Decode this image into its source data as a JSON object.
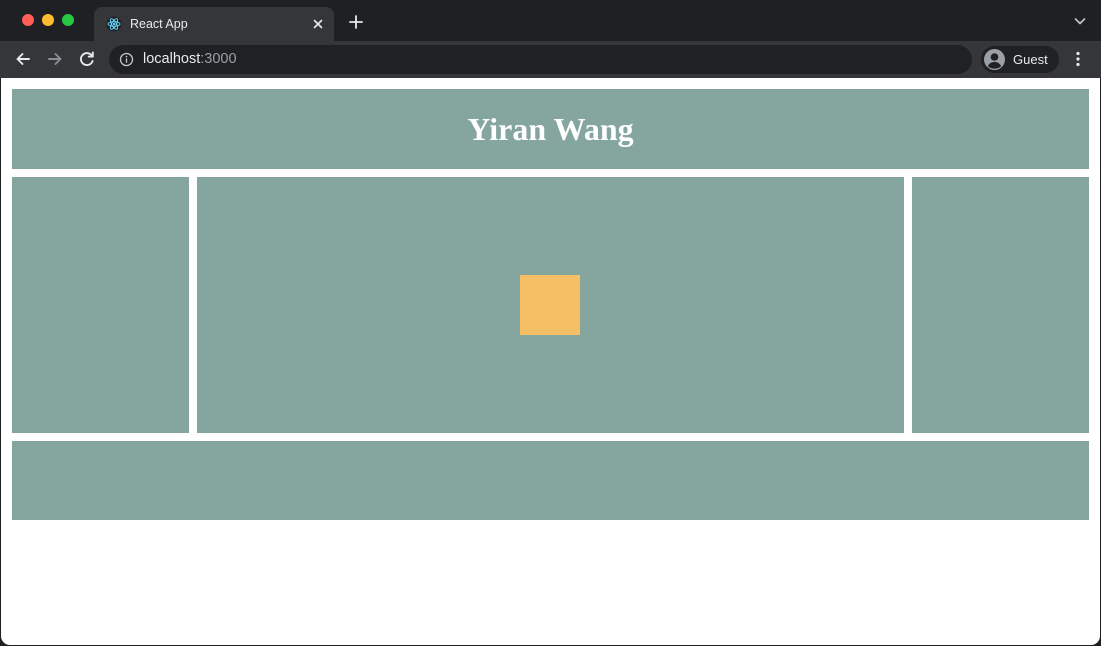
{
  "browser": {
    "tab": {
      "title": "React App",
      "favicon": "react-logo-icon",
      "close_icon": "close-icon"
    },
    "new_tab_icon": "plus-icon",
    "tab_search_icon": "chevron-down-icon",
    "toolbar": {
      "back_icon": "back-arrow-icon",
      "forward_icon": "forward-arrow-icon",
      "reload_icon": "reload-icon",
      "site_info_icon": "info-icon",
      "url_host": "localhost",
      "url_port": ":3000",
      "profile_label": "Guest",
      "profile_icon": "avatar-icon",
      "menu_icon": "kebab-menu-icon"
    }
  },
  "page": {
    "header_title": "Yiran Wang",
    "colors": {
      "panel": "#85a69e",
      "square": "#f4bf65",
      "background": "#ffffff"
    }
  }
}
